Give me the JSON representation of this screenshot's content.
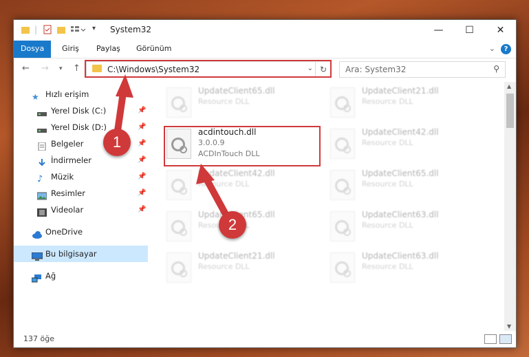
{
  "window": {
    "title": "System32",
    "controls": {
      "minimize": "—",
      "maximize": "☐",
      "close": "✕"
    }
  },
  "ribbon": {
    "tabs": [
      "Dosya",
      "Giriş",
      "Paylaş",
      "Görünüm"
    ],
    "help": "?"
  },
  "address": {
    "path": "C:\\Windows\\System32",
    "search_placeholder": "Ara: System32"
  },
  "sidebar": {
    "items": [
      {
        "label": "Hızlı erişim",
        "icon": "star-icon"
      },
      {
        "label": "Yerel Disk (C:)",
        "icon": "drive-icon",
        "pinned": true
      },
      {
        "label": "Yerel Disk (D:)",
        "icon": "drive-icon",
        "pinned": true
      },
      {
        "label": "Belgeler",
        "icon": "documents-icon",
        "pinned": true
      },
      {
        "label": "İndirmeler",
        "icon": "download-icon",
        "pinned": true
      },
      {
        "label": "Müzik",
        "icon": "music-icon",
        "pinned": true
      },
      {
        "label": "Resimler",
        "icon": "pictures-icon",
        "pinned": true
      },
      {
        "label": "Videolar",
        "icon": "videos-icon",
        "pinned": true
      },
      {
        "label": "OneDrive",
        "icon": "cloud-icon"
      },
      {
        "label": "Bu bilgisayar",
        "icon": "computer-icon",
        "selected": true
      },
      {
        "label": "Ağ",
        "icon": "network-icon"
      }
    ]
  },
  "files": [
    {
      "name": "UpdateClient65.dll",
      "type": "Resource DLL"
    },
    {
      "name": "UpdateClient21.dll",
      "type": "Resource DLL"
    },
    {
      "name": "acdintouch.dll",
      "version": "3.0.0.9",
      "type": "ACDInTouch DLL"
    },
    {
      "name": "UpdateClient42.dll",
      "type": "Resource DLL"
    },
    {
      "name": "UpdateClient42.dll",
      "type": "Resource DLL"
    },
    {
      "name": "UpdateClient65.dll",
      "type": "Resource DLL"
    },
    {
      "name": "UpdateClient65.dll",
      "type": "Resource DLL"
    },
    {
      "name": "UpdateClient63.dll",
      "type": "Resource DLL"
    },
    {
      "name": "UpdateClient21.dll",
      "type": "Resource DLL"
    },
    {
      "name": "UpdateClient63.dll",
      "type": "Resource DLL"
    }
  ],
  "status": {
    "count": "137 öğe"
  },
  "annotations": {
    "step1": "1",
    "step2": "2",
    "color": "#d0393a"
  }
}
